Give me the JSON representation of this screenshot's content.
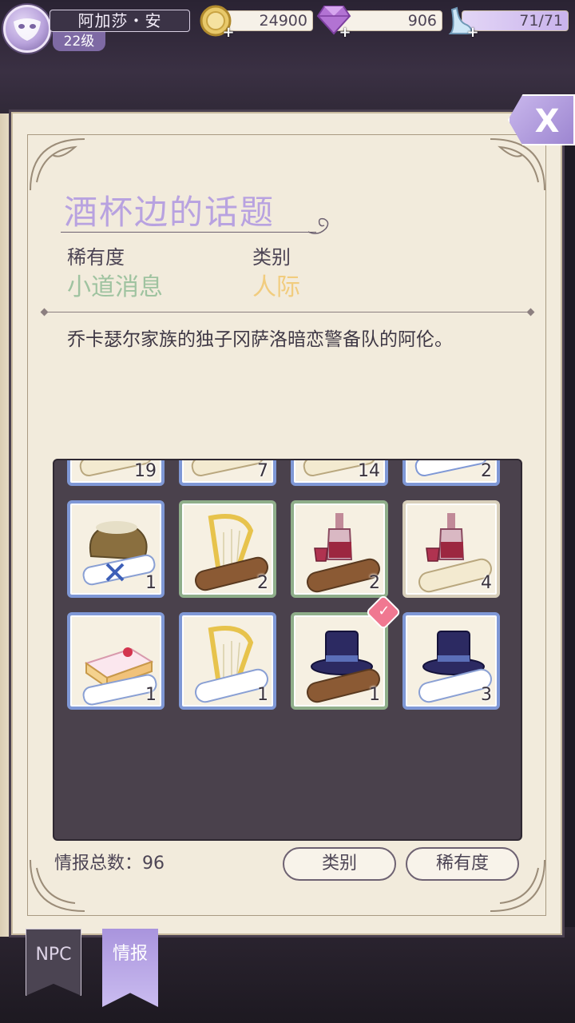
{
  "player": {
    "name": "阿加莎・安",
    "level": "22级"
  },
  "resources": {
    "gold": "24900",
    "diamond": "906",
    "stamina": "71/71"
  },
  "colors": {
    "title": "#b8a2e0",
    "rarity_value": "#9fc3a0",
    "category_value": "#f1cc7e",
    "accent_purple": "#a994dd"
  },
  "intel": {
    "title": "酒杯边的话题",
    "rarity_label": "稀有度",
    "rarity_value": "小道消息",
    "category_label": "类别",
    "category_value": "人际",
    "description": "乔卡瑟尔家族的独子冈萨洛暗恋警备队的阿伦。"
  },
  "grid": {
    "partial_row": [
      {
        "icon": "scroll-icon",
        "count": "19"
      },
      {
        "icon": "scroll-icon",
        "count": "7"
      },
      {
        "icon": "scroll-icon",
        "count": "14"
      },
      {
        "icon": "scroll-icon",
        "count": "2"
      }
    ],
    "rows": [
      [
        {
          "icon": "money-bag-scroll-icon",
          "count": "1"
        },
        {
          "icon": "harp-scroll-icon",
          "count": "2"
        },
        {
          "icon": "wine-scroll-icon",
          "count": "2"
        },
        {
          "icon": "wine-scroll-icon",
          "count": "4"
        }
      ],
      [
        {
          "icon": "cake-scroll-icon",
          "count": "1"
        },
        {
          "icon": "harp-scroll-icon",
          "count": "1"
        },
        {
          "icon": "top-hat-scroll-icon",
          "count": "1",
          "selected": true
        },
        {
          "icon": "top-hat-scroll-icon",
          "count": "3"
        }
      ]
    ]
  },
  "footer": {
    "total_label": "情报总数：96",
    "category_button": "类别",
    "rarity_button": "稀有度"
  },
  "tabs": {
    "npc": "NPC",
    "intel": "情报"
  },
  "close_label": "X"
}
